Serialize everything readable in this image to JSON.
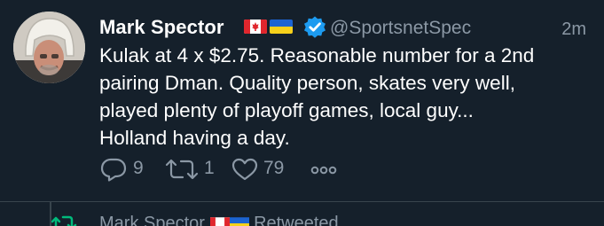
{
  "tweet": {
    "author": {
      "name": "Mark Spector",
      "handle": "@SportsnetSpec",
      "avatar_icon": "profile-photo",
      "flags": [
        "canada-flag-icon",
        "ukraine-flag-icon"
      ],
      "verified_icon": "verified-badge-icon"
    },
    "timestamp": "2m",
    "text": "Kulak at 4 x $2.75. Reasonable number for a 2nd\npairing Dman. Quality person, skates very well,\nplayed plenty of playoff games, local guy...\nHolland having a day.",
    "actions": {
      "replies": "9",
      "retweets": "1",
      "likes": "79",
      "more_label": "ooo"
    }
  },
  "next_item": {
    "name": "Mark Spector",
    "suffix": "Retweeted",
    "icon": "retweet-icon"
  },
  "colors": {
    "background": "#15202b",
    "text": "#ffffff",
    "secondary": "#8b98a5",
    "verified": "#1d9bf0",
    "retweet_green": "#00ba7c",
    "divider": "#38444d"
  }
}
